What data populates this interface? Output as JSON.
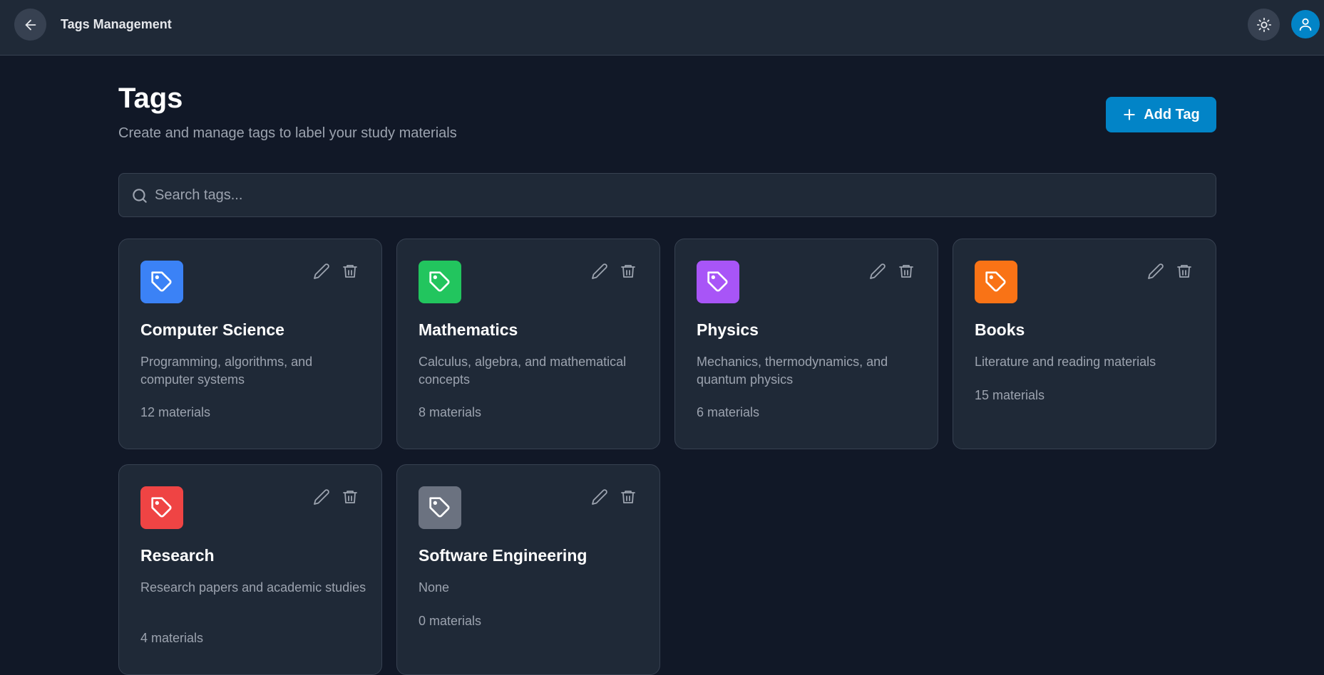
{
  "header": {
    "title": "Tags Management"
  },
  "page": {
    "title": "Tags",
    "subtitle": "Create and manage tags to label your study materials",
    "add_button_label": "Add Tag"
  },
  "search": {
    "placeholder": "Search tags...",
    "value": ""
  },
  "tags": [
    {
      "name": "Computer Science",
      "description": "Programming, algorithms, and computer systems",
      "count": "12 materials",
      "color": "#3b82f6"
    },
    {
      "name": "Mathematics",
      "description": "Calculus, algebra, and mathematical concepts",
      "count": "8 materials",
      "color": "#22c55e"
    },
    {
      "name": "Physics",
      "description": "Mechanics, thermodynamics, and quantum physics",
      "count": "6 materials",
      "color": "#a855f7"
    },
    {
      "name": "Books",
      "description": "Literature and reading materials",
      "count": "15 materials",
      "color": "#f97316"
    },
    {
      "name": "Research",
      "description": "Research papers and academic studies",
      "count": "4 materials",
      "color": "#ef4444"
    },
    {
      "name": "Software Engineering",
      "description": "None",
      "count": "0 materials",
      "color": "#6b7280"
    }
  ],
  "icons": {
    "back": "arrow-left-icon",
    "theme": "sun-icon",
    "user": "user-icon",
    "add": "plus-icon",
    "search": "search-icon",
    "tag": "tag-icon",
    "edit": "pencil-icon",
    "delete": "trash-icon"
  }
}
